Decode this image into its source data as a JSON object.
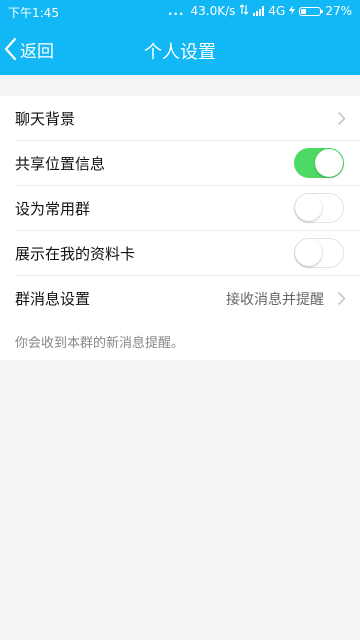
{
  "status_bar": {
    "time": "下午1:45",
    "dots": "...",
    "network_speed": "43.0K/s",
    "network_type": "4G",
    "battery_percent": "27%",
    "battery_level": 0.27,
    "icons": [
      "data-transfer-icon",
      "signal-icon",
      "charging-icon",
      "battery-icon"
    ]
  },
  "header": {
    "back_label": "返回",
    "title": "个人设置"
  },
  "settings": {
    "chat_background": {
      "label": "聊天背景"
    },
    "share_location": {
      "label": "共享位置信息",
      "enabled": true
    },
    "frequent_group": {
      "label": "设为常用群",
      "enabled": false
    },
    "show_on_profile": {
      "label": "展示在我的资料卡",
      "enabled": false
    },
    "group_message": {
      "label": "群消息设置",
      "value": "接收消息并提醒"
    }
  },
  "hint": "你会收到本群的新消息提醒。",
  "colors": {
    "header_blue": "#12b7f5",
    "toggle_on": "#4cd964",
    "background": "#f4f4f6"
  }
}
